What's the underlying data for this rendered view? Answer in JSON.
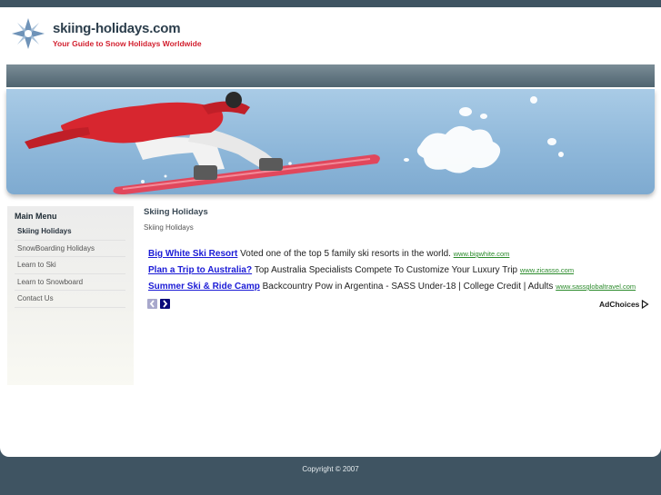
{
  "header": {
    "site_name": "skiing-holidays.com",
    "tagline": "Your Guide to Snow Holidays Worldwide"
  },
  "sidebar": {
    "title": "Main Menu",
    "items": [
      {
        "label": "Skiing Holidays"
      },
      {
        "label": "SnowBoarding Holidays"
      },
      {
        "label": "Learn to Ski"
      },
      {
        "label": "Learn to Snowboard"
      },
      {
        "label": "Contact Us"
      }
    ]
  },
  "content": {
    "title": "Skiing Holidays",
    "subtitle": "Skiing Holidays"
  },
  "ads": [
    {
      "title": "Big White Ski Resort",
      "text": "Voted one of the top 5 family ski resorts in the world.",
      "url": "www.bigwhite.com"
    },
    {
      "title": "Plan a Trip to Australia?",
      "text": "Top Australia Specialists Compete To Customize Your Luxury Trip",
      "url": "www.zicasso.com"
    },
    {
      "title": "Summer Ski & Ride Camp",
      "text": "Backcountry Pow in Argentina - SASS Under-18 | College Credit | Adults",
      "url": "www.sassglobaltravel.com"
    }
  ],
  "adchoices": {
    "label": "AdChoices"
  },
  "footer": {
    "copyright": "Copyright © 2007"
  },
  "colors": {
    "background": "#3f5462",
    "tagline": "#d21f2e",
    "ad_link": "#1b1bd6",
    "ad_url": "#2a8a2a"
  }
}
